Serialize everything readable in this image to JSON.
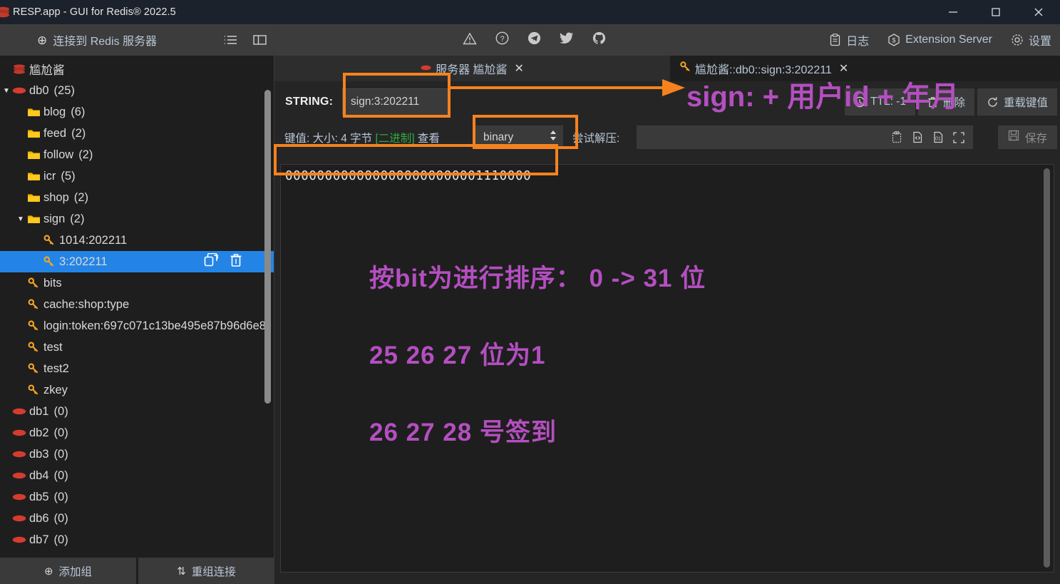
{
  "window": {
    "title": "RESP.app - GUI for Redis® 2022.5",
    "controls": {
      "minimize": "—",
      "maximize": "□",
      "close": "✕"
    }
  },
  "sidebar": {
    "connect_label": "连接到 Redis 服务器",
    "connect_icon": "plus-circle-icon",
    "toolbar_icons": [
      "list-view-icon",
      "split-panel-icon"
    ],
    "tree": [
      {
        "label": "尴尬酱",
        "count": "",
        "icon": "server-stack-icon",
        "indent": 0,
        "caret": "",
        "selected": false
      },
      {
        "label": "db0",
        "count": "(25)",
        "icon": "db-icon",
        "indent": 0,
        "caret": "▼",
        "selected": false
      },
      {
        "label": "blog",
        "count": "(6)",
        "icon": "folder-icon",
        "indent": 1,
        "caret": "",
        "selected": false
      },
      {
        "label": "feed",
        "count": "(2)",
        "icon": "folder-icon",
        "indent": 1,
        "caret": "",
        "selected": false
      },
      {
        "label": "follow",
        "count": "(2)",
        "icon": "folder-icon",
        "indent": 1,
        "caret": "",
        "selected": false
      },
      {
        "label": "icr",
        "count": "(5)",
        "icon": "folder-icon",
        "indent": 1,
        "caret": "",
        "selected": false
      },
      {
        "label": "shop",
        "count": "(2)",
        "icon": "folder-icon",
        "indent": 1,
        "caret": "",
        "selected": false
      },
      {
        "label": "sign",
        "count": "(2)",
        "icon": "folder-icon",
        "indent": 1,
        "caret": "▼",
        "selected": false
      },
      {
        "label": "1014:202211",
        "count": "",
        "icon": "key-icon",
        "indent": 2,
        "caret": "",
        "selected": false
      },
      {
        "label": "3:202211",
        "count": "",
        "icon": "key-icon",
        "indent": 2,
        "caret": "",
        "selected": true
      },
      {
        "label": "bits",
        "count": "",
        "icon": "key-icon",
        "indent": 1,
        "caret": "",
        "selected": false
      },
      {
        "label": "cache:shop:type",
        "count": "",
        "icon": "key-icon",
        "indent": 1,
        "caret": "",
        "selected": false
      },
      {
        "label": "login:token:697c071c13be495e87b96d6e8",
        "count": "",
        "icon": "key-icon",
        "indent": 1,
        "caret": "",
        "selected": false
      },
      {
        "label": "test",
        "count": "",
        "icon": "key-icon",
        "indent": 1,
        "caret": "",
        "selected": false
      },
      {
        "label": "test2",
        "count": "",
        "icon": "key-icon",
        "indent": 1,
        "caret": "",
        "selected": false
      },
      {
        "label": "zkey",
        "count": "",
        "icon": "key-icon",
        "indent": 1,
        "caret": "",
        "selected": false
      },
      {
        "label": "db1",
        "count": "(0)",
        "icon": "db-icon",
        "indent": 0,
        "caret": "",
        "selected": false
      },
      {
        "label": "db2",
        "count": "(0)",
        "icon": "db-icon",
        "indent": 0,
        "caret": "",
        "selected": false
      },
      {
        "label": "db3",
        "count": "(0)",
        "icon": "db-icon",
        "indent": 0,
        "caret": "",
        "selected": false
      },
      {
        "label": "db4",
        "count": "(0)",
        "icon": "db-icon",
        "indent": 0,
        "caret": "",
        "selected": false
      },
      {
        "label": "db5",
        "count": "(0)",
        "icon": "db-icon",
        "indent": 0,
        "caret": "",
        "selected": false
      },
      {
        "label": "db6",
        "count": "(0)",
        "icon": "db-icon",
        "indent": 0,
        "caret": "",
        "selected": false
      },
      {
        "label": "db7",
        "count": "(0)",
        "icon": "db-icon",
        "indent": 0,
        "caret": "",
        "selected": false
      }
    ],
    "row_actions": {
      "copy": "copy-key-icon",
      "delete": "trash-icon"
    },
    "bottom": {
      "add_group": "添加组",
      "add_group_icon": "plus-circle-icon",
      "reconnect": "重组连接",
      "reconnect_icon": "sort-arrows-icon"
    }
  },
  "topbar": {
    "center_icons": [
      "warning-triangle-icon",
      "help-circle-icon",
      "telegram-icon",
      "twitter-icon",
      "github-icon"
    ],
    "right_items": [
      {
        "label": "日志",
        "icon": "clipboard-icon"
      },
      {
        "label": "Extension Server",
        "icon": "extension-icon"
      },
      {
        "label": "设置",
        "icon": "gear-icon"
      }
    ]
  },
  "tabs": [
    {
      "label": "服务器 尴尬酱",
      "icon": "db-icon",
      "close": "✕",
      "active": false
    },
    {
      "label": "尴尬酱::db0::sign:3:202211",
      "icon": "key-icon",
      "close": "✕",
      "active": true
    }
  ],
  "key_header": {
    "type_label": "STRING:",
    "key_name": "sign:3:202211",
    "ttl_label": "TTL: -1",
    "ttl_icon": "clock-icon",
    "delete_label": "删除",
    "delete_icon": "trash-icon",
    "reload_label": "重载键值",
    "reload_icon": "refresh-icon"
  },
  "meta_row": {
    "prefix": "键值: 大小: 4 字节",
    "binary_tag": "[二进制]",
    "view_label": "查看",
    "format_value": "binary",
    "stepper_icon": "chevron-updown-icon",
    "unzip_label": "尝试解压:",
    "unzip_value": "",
    "tool_icons": [
      "paste-icon",
      "code-file-icon",
      "binary-file-icon",
      "fullscreen-icon"
    ],
    "save_label": "保存",
    "save_icon": "floppy-icon"
  },
  "value": {
    "binary": "0000000000000000000000001110000"
  },
  "annotations": {
    "key_arrow_note": "sign: + 用户id + 年月",
    "line1": "按bit为进行排序： 0 -> 31 位",
    "line2": "25  26  27  位为1",
    "line3": "26  27  28  号签到",
    "highlight_color": "#f5821f",
    "note_color": "#b44fc0"
  }
}
